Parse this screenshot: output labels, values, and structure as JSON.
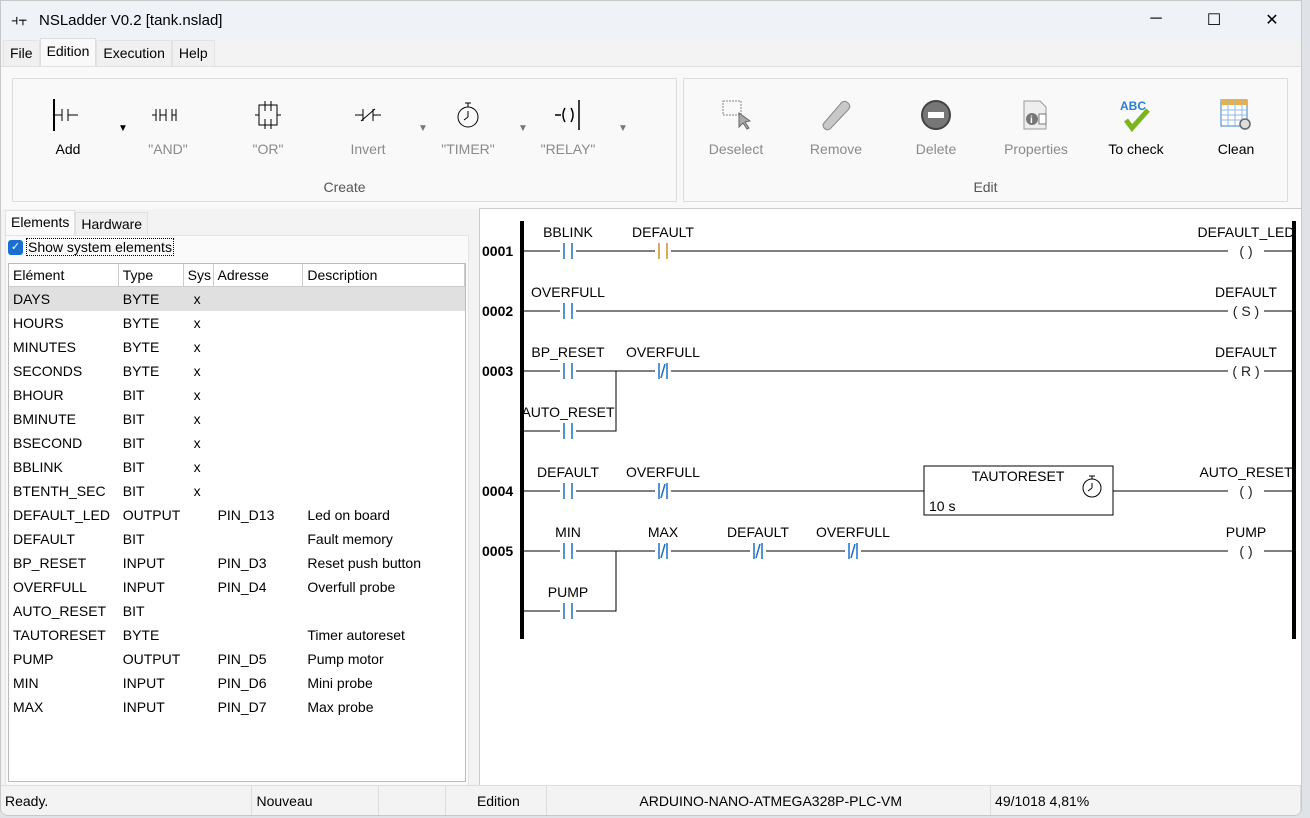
{
  "window": {
    "title": "NSLadder V0.2  [tank.nslad]",
    "minimize": "─",
    "maximize": "☐",
    "close": "✕"
  },
  "menu": [
    "File",
    "Edition",
    "Execution",
    "Help"
  ],
  "ribbon": {
    "create": {
      "label": "Create",
      "buttons": [
        {
          "label": "Add",
          "icon": "add-contact-icon",
          "enabled": true,
          "dropdown": true
        },
        {
          "label": "\"AND\"",
          "icon": "and-icon",
          "enabled": false,
          "dropdown": false
        },
        {
          "label": "\"OR\"",
          "icon": "or-icon",
          "enabled": false,
          "dropdown": false
        },
        {
          "label": "Invert",
          "icon": "invert-icon",
          "enabled": false,
          "dropdown": true
        },
        {
          "label": "\"TIMER\"",
          "icon": "timer-icon",
          "enabled": false,
          "dropdown": true
        },
        {
          "label": "\"RELAY\"",
          "icon": "relay-icon",
          "enabled": false,
          "dropdown": true
        }
      ]
    },
    "edit": {
      "label": "Edit",
      "buttons": [
        {
          "label": "Deselect",
          "icon": "deselect-icon",
          "enabled": false
        },
        {
          "label": "Remove",
          "icon": "eraser-icon",
          "enabled": false
        },
        {
          "label": "Delete",
          "icon": "delete-icon",
          "enabled": false
        },
        {
          "label": "Properties",
          "icon": "properties-icon",
          "enabled": false
        },
        {
          "label": "To check",
          "icon": "spellcheck-icon",
          "enabled": true
        },
        {
          "label": "Clean",
          "icon": "clean-table-icon",
          "enabled": true
        }
      ]
    }
  },
  "left": {
    "tabs": [
      "Elements",
      "Hardware"
    ],
    "show_system": {
      "label": "Show system elements",
      "checked": true
    },
    "columns": [
      "Elément",
      "Type",
      "Sys",
      "Adresse",
      "Description"
    ],
    "rows": [
      [
        "DAYS",
        "BYTE",
        "x",
        "",
        ""
      ],
      [
        "HOURS",
        "BYTE",
        "x",
        "",
        ""
      ],
      [
        "MINUTES",
        "BYTE",
        "x",
        "",
        ""
      ],
      [
        "SECONDS",
        "BYTE",
        "x",
        "",
        ""
      ],
      [
        "BHOUR",
        "BIT",
        "x",
        "",
        ""
      ],
      [
        "BMINUTE",
        "BIT",
        "x",
        "",
        ""
      ],
      [
        "BSECOND",
        "BIT",
        "x",
        "",
        ""
      ],
      [
        "BBLINK",
        "BIT",
        "x",
        "",
        ""
      ],
      [
        "BTENTH_SEC",
        "BIT",
        "x",
        "",
        ""
      ],
      [
        "DEFAULT_LED",
        "OUTPUT",
        "",
        "PIN_D13",
        "Led on board"
      ],
      [
        "DEFAULT",
        "BIT",
        "",
        "",
        "Fault memory"
      ],
      [
        "BP_RESET",
        "INPUT",
        "",
        "PIN_D3",
        "Reset push button"
      ],
      [
        "OVERFULL",
        "INPUT",
        "",
        "PIN_D4",
        "Overfull probe"
      ],
      [
        "AUTO_RESET",
        "BIT",
        "",
        "",
        ""
      ],
      [
        "TAUTORESET",
        "BYTE",
        "",
        "",
        "Timer autoreset"
      ],
      [
        "PUMP",
        "OUTPUT",
        "",
        "PIN_D5",
        "Pump motor"
      ],
      [
        "MIN",
        "INPUT",
        "",
        "PIN_D6",
        "Mini probe"
      ],
      [
        "MAX",
        "INPUT",
        "",
        "PIN_D7",
        "Max probe"
      ]
    ]
  },
  "ladder": {
    "contact_color": "#1f6fc5",
    "active_color": "#d08a2a",
    "rungs": [
      {
        "number": "0001",
        "contacts": [
          {
            "name": "BBLINK",
            "type": "NO",
            "col": 0
          },
          {
            "name": "DEFAULT",
            "type": "NO",
            "col": 1,
            "active": true
          }
        ],
        "coil": {
          "name": "DEFAULT_LED",
          "symbol": "( )"
        }
      },
      {
        "number": "0002",
        "contacts": [
          {
            "name": "OVERFULL",
            "type": "NO",
            "col": 0
          }
        ],
        "coil": {
          "name": "DEFAULT",
          "symbol": "( S )"
        }
      },
      {
        "number": "0003",
        "contacts": [
          {
            "name": "BP_RESET",
            "type": "NO",
            "col": 0
          },
          {
            "name": "OVERFULL",
            "type": "NC",
            "col": 1
          }
        ],
        "branch": {
          "name": "AUTO_RESET",
          "type": "NO"
        },
        "coil": {
          "name": "DEFAULT",
          "symbol": "( R )"
        }
      },
      {
        "number": "0004",
        "contacts": [
          {
            "name": "DEFAULT",
            "type": "NO",
            "col": 0
          },
          {
            "name": "OVERFULL",
            "type": "NC",
            "col": 1
          }
        ],
        "timer": {
          "name": "TAUTORESET",
          "preset": "10 s"
        },
        "coil": {
          "name": "AUTO_RESET",
          "symbol": "( )"
        }
      },
      {
        "number": "0005",
        "contacts": [
          {
            "name": "MIN",
            "type": "NO",
            "col": 0
          },
          {
            "name": "MAX",
            "type": "NC",
            "col": 1
          },
          {
            "name": "DEFAULT",
            "type": "NC",
            "col": 2
          },
          {
            "name": "OVERFULL",
            "type": "NC",
            "col": 3
          }
        ],
        "branch": {
          "name": "PUMP",
          "type": "NO"
        },
        "coil": {
          "name": "PUMP",
          "symbol": "( )"
        }
      }
    ]
  },
  "status": [
    "Ready.",
    "Nouveau",
    "",
    "Edition",
    "ARDUINO-NANO-ATMEGA328P-PLC-VM",
    "49/1018   4,81%"
  ]
}
